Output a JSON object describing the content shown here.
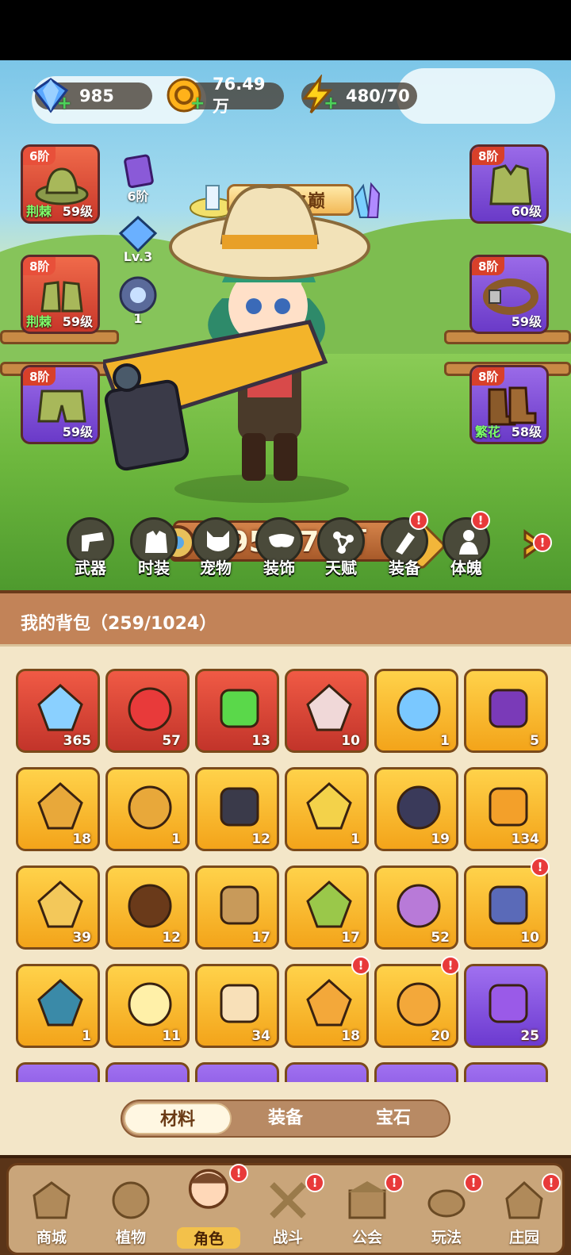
{
  "currencies": [
    {
      "name": "diamond-icon",
      "value": "985"
    },
    {
      "name": "coin-icon",
      "value": "76.49万"
    },
    {
      "name": "energy-icon",
      "value": "480/70"
    }
  ],
  "stage": {
    "title": "试炼之巅"
  },
  "left_equipment": [
    {
      "tier": "6阶",
      "tag": "荆棘",
      "level": "59级",
      "icon": "hat-icon",
      "color": "red"
    },
    {
      "tier": "8阶",
      "tag": "荆棘",
      "level": "59级",
      "icon": "gloves-icon",
      "color": "red"
    },
    {
      "tier": "8阶",
      "tag": "",
      "level": "59级",
      "icon": "shorts-icon",
      "color": "purple"
    }
  ],
  "right_equipment": [
    {
      "tier": "8阶",
      "tag": "",
      "level": "60级",
      "icon": "vest-icon",
      "color": "purple"
    },
    {
      "tier": "8阶",
      "tag": "",
      "level": "59级",
      "icon": "belt-icon",
      "color": "purple"
    },
    {
      "tier": "8阶",
      "tag": "繁花",
      "level": "58级",
      "icon": "boots-icon",
      "color": "purple"
    }
  ],
  "side_minis": [
    {
      "label": "6阶",
      "icon": "paw-card-icon"
    },
    {
      "label": "Lv.3",
      "icon": "crystal-icon"
    },
    {
      "label": "1",
      "icon": "orb-icon"
    }
  ],
  "power": {
    "value": "954.70万"
  },
  "functions": [
    {
      "label": "武器",
      "icon": "weapon-icon",
      "badge": false
    },
    {
      "label": "时装",
      "icon": "outfit-icon",
      "badge": false
    },
    {
      "label": "宠物",
      "icon": "pet-icon",
      "badge": false
    },
    {
      "label": "装饰",
      "icon": "mask-icon",
      "badge": false
    },
    {
      "label": "天赋",
      "icon": "talent-icon",
      "badge": false
    },
    {
      "label": "装备",
      "icon": "equipment-icon",
      "badge": true
    },
    {
      "label": "体魄",
      "icon": "physique-icon",
      "badge": true
    }
  ],
  "bag": {
    "title": "我的背包（259/1024）"
  },
  "items": [
    {
      "qty": "365",
      "color": "red",
      "icon": "star-crystal-icon",
      "alert": false
    },
    {
      "qty": "57",
      "color": "red",
      "icon": "red-potion-icon",
      "alert": false
    },
    {
      "qty": "13",
      "color": "red",
      "icon": "green-vial-icon",
      "alert": false
    },
    {
      "qty": "10",
      "color": "red",
      "icon": "knot-emblem-icon",
      "alert": false
    },
    {
      "qty": "1",
      "color": "gold",
      "icon": "water-drop-icon",
      "alert": false
    },
    {
      "qty": "5",
      "color": "gold",
      "icon": "skull-scroll-icon",
      "alert": false
    },
    {
      "qty": "18",
      "color": "gold",
      "icon": "gold-key-icon",
      "alert": false
    },
    {
      "qty": "1",
      "color": "gold",
      "icon": "gem-key-icon",
      "alert": false
    },
    {
      "qty": "12",
      "color": "gold",
      "icon": "prism-icon",
      "alert": false
    },
    {
      "qty": "1",
      "color": "gold",
      "icon": "gold-flower-icon",
      "alert": false
    },
    {
      "qty": "19",
      "color": "gold",
      "icon": "rune-stone-icon",
      "alert": false
    },
    {
      "qty": "134",
      "color": "gold",
      "icon": "orange-potion-icon",
      "alert": false
    },
    {
      "qty": "39",
      "color": "gold",
      "icon": "sand-pile-icon",
      "alert": false
    },
    {
      "qty": "12",
      "color": "gold",
      "icon": "ore-icon",
      "alert": false
    },
    {
      "qty": "17",
      "color": "gold",
      "icon": "flower-pot-icon",
      "alert": false
    },
    {
      "qty": "17",
      "color": "gold",
      "icon": "sprayer-icon",
      "alert": false
    },
    {
      "qty": "52",
      "color": "gold",
      "icon": "spell-book-icon",
      "alert": false
    },
    {
      "qty": "10",
      "color": "gold",
      "icon": "film-roll-icon",
      "alert": true
    },
    {
      "qty": "1",
      "color": "gold",
      "icon": "chip-icon",
      "alert": false
    },
    {
      "qty": "11",
      "color": "gold",
      "icon": "glow-flower-icon",
      "alert": false
    },
    {
      "qty": "34",
      "color": "gold",
      "icon": "knot-cookie-icon",
      "alert": false
    },
    {
      "qty": "18",
      "color": "gold",
      "icon": "mystery-seed-icon",
      "alert": true
    },
    {
      "qty": "20",
      "color": "gold",
      "icon": "mystery-lotus-icon",
      "alert": true
    },
    {
      "qty": "25",
      "color": "purple",
      "icon": "purple-bottle-icon",
      "alert": false
    }
  ],
  "tabs": [
    {
      "label": "材料",
      "active": true
    },
    {
      "label": "装备",
      "active": false
    },
    {
      "label": "宝石",
      "active": false
    }
  ],
  "nav": [
    {
      "label": "商城",
      "icon": "shop-icon",
      "badge": false,
      "active": false
    },
    {
      "label": "植物",
      "icon": "plant-icon",
      "badge": false,
      "active": false
    },
    {
      "label": "角色",
      "icon": "character-icon",
      "badge": true,
      "active": true
    },
    {
      "label": "战斗",
      "icon": "battle-icon",
      "badge": true,
      "active": false
    },
    {
      "label": "公会",
      "icon": "guild-icon",
      "badge": true,
      "active": false
    },
    {
      "label": "玩法",
      "icon": "gameplay-icon",
      "badge": true,
      "active": false
    },
    {
      "label": "庄园",
      "icon": "manor-icon",
      "badge": true,
      "active": false
    }
  ]
}
